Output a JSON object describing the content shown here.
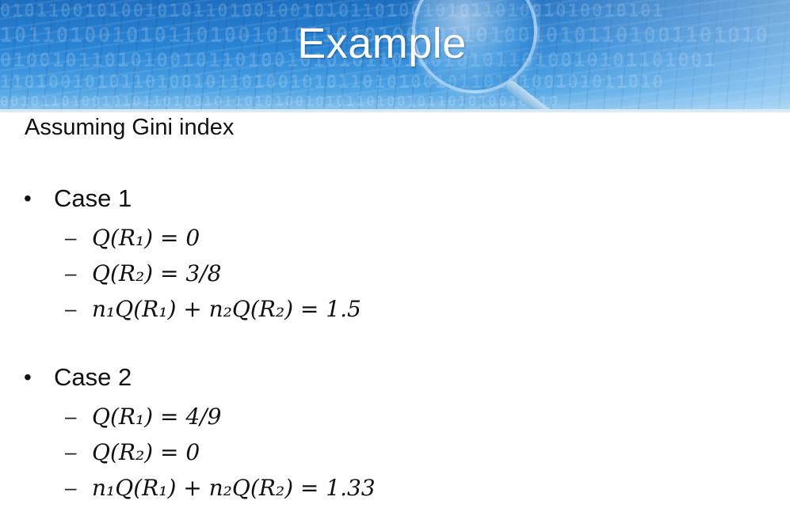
{
  "slide": {
    "title": "Example",
    "subtitle": "Assuming Gini index"
  },
  "banner": {
    "digits_rows": [
      "0101100101001010110100100101011010010101101001010010101",
      "1011010010101101001010110101001011010010101101001101010",
      "0100101101010010110100101010110100101011010010101101001",
      "1101001010110100101101001010110101001011010100101011010",
      "0010110100101011010010110101001010110100101101010010110"
    ],
    "colors": {
      "top": "#1d6fc0",
      "bottom": "#8fc5ee"
    }
  },
  "cases": [
    {
      "label": "Case 1",
      "formulas": [
        "Q(R₁) = 0",
        "Q(R₂) = 3/8",
        "n₁Q(R₁) + n₂Q(R₂) = 1.5"
      ]
    },
    {
      "label": "Case 2",
      "formulas": [
        "Q(R₁) = 4/9",
        "Q(R₂) = 0",
        "n₁Q(R₁) + n₂Q(R₂) = 1.33"
      ]
    }
  ],
  "symbols": {
    "bullet": "•",
    "dash": "–"
  }
}
